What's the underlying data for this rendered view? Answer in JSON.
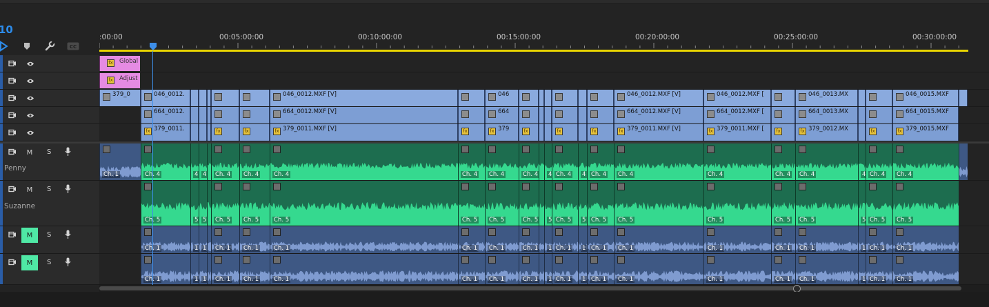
{
  "timeline": {
    "timecode": "10",
    "ruler_labels": [
      ":00:00",
      "00:05:00:00",
      "00:10:00:00",
      "00:15:00:00",
      "00:20:00:00",
      "00:25:00:00",
      "00:30:00:00"
    ],
    "toolbar_icons": [
      "snap-icon",
      "marker-icon",
      "settings-wrench-icon",
      "captions-icon"
    ]
  },
  "tracks": {
    "video": [
      {
        "id": "V5",
        "clips_label": [
          "Global"
        ]
      },
      {
        "id": "V4",
        "clips_label": [
          "Adjust"
        ]
      },
      {
        "id": "V3",
        "lead": "379_0",
        "first": "046_0012.",
        "main": "046_0012.MXF [V]",
        "short": "046",
        "cluster1": "046_0012.MXF [V]",
        "cluster2": "046_0012.MXF [",
        "cluster3": "046_0013.MX",
        "cluster4": "046_0015.MXF"
      },
      {
        "id": "V2",
        "first": "664_0012.",
        "main": "664_0012.MXF [V]",
        "short": "664",
        "cluster1": "664_0012.MXF [V]",
        "cluster2": "664_0012.MXF [",
        "cluster3": "664_0013.MX",
        "cluster4": "664_0015.MXF"
      },
      {
        "id": "V1",
        "first": "379_0011.",
        "main": "379_0011.MXF [V]",
        "short": "379",
        "cluster1": "379_0011.MXF [V]",
        "cluster2": "379_0011.MXF [",
        "cluster3": "379_0012.MX",
        "cluster4": "379_0015.MXF"
      }
    ],
    "audio": [
      {
        "name": "Penny",
        "m": "M",
        "s": "S",
        "mute_on": false,
        "channel": "Ch. 4",
        "lead_channel": "Ch. 1",
        "short": "4"
      },
      {
        "name": "Suzanne",
        "m": "M",
        "s": "S",
        "mute_on": false,
        "channel": "Ch. 5",
        "short": "5"
      },
      {
        "name": "",
        "m": "M",
        "s": "S",
        "mute_on": true,
        "channel": "Ch. 1",
        "short": "1"
      },
      {
        "name": "",
        "m": "M",
        "s": "S",
        "mute_on": true,
        "channel": "Ch. 1",
        "short": "1"
      }
    ]
  },
  "colors": {
    "accent_blue": "#2d8ceb",
    "work_area": "#e8d400",
    "video_clip": "#7d9ed4",
    "adjustment_clip": "#e58be3",
    "audio_clip_green": "#1d6d4f",
    "waveform_green": "#35d98f",
    "audio_clip_blue": "#3e5884",
    "waveform_blue": "#7f9bd0",
    "mute_on": "#4fe8a5"
  }
}
